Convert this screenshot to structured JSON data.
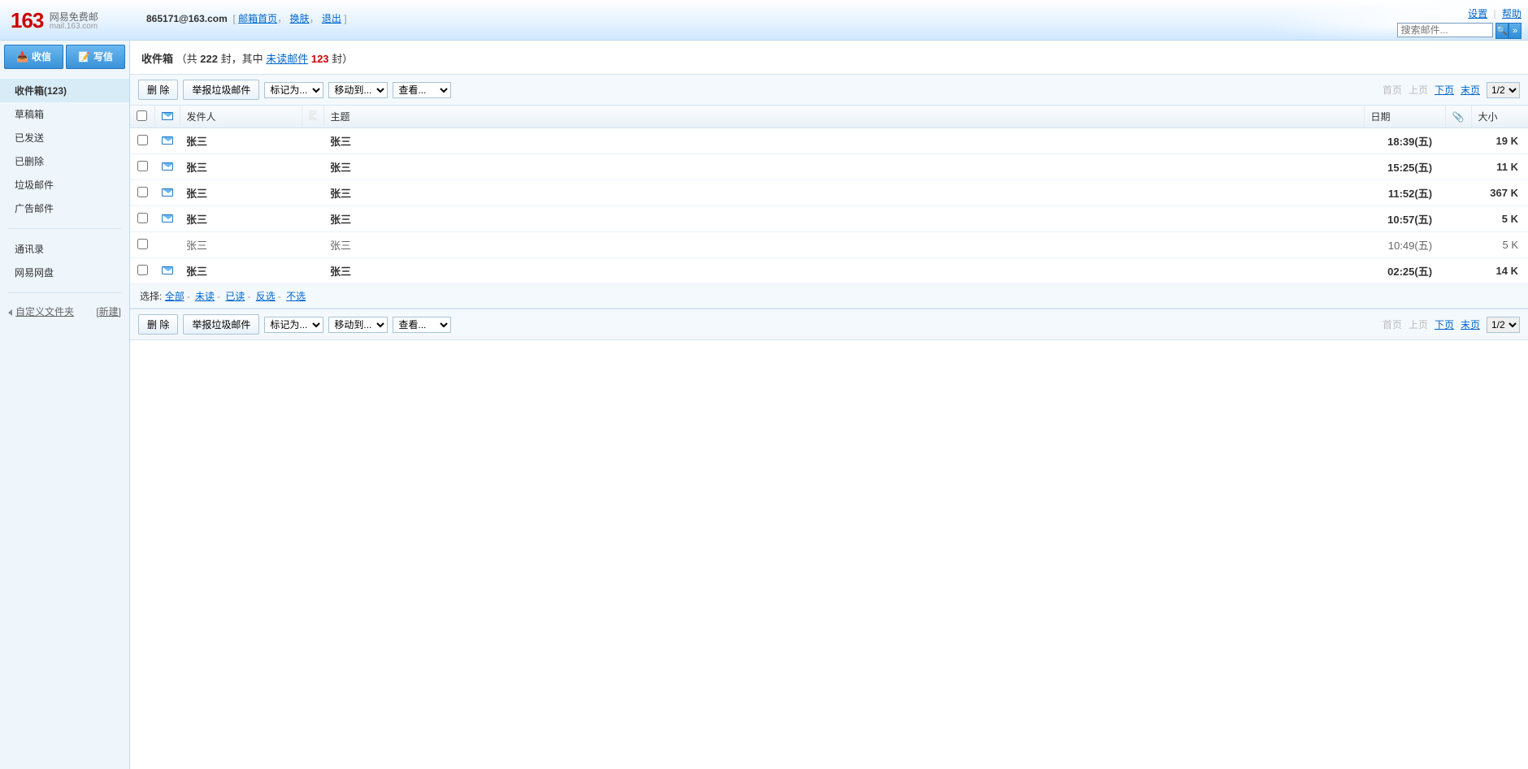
{
  "header": {
    "logo_num": "163",
    "logo_text": "网易免费邮",
    "logo_sub": "mail.163.com",
    "user_email": "865171@163.com",
    "links": {
      "home": "邮箱首页",
      "switch": "换肤",
      "logout": "退出"
    },
    "settings": "设置",
    "help": "帮助",
    "search_placeholder": "搜索邮件..."
  },
  "sidebar": {
    "receive": "收信",
    "compose": "写信",
    "folders": [
      {
        "label": "收件箱(123)",
        "active": true
      },
      {
        "label": "草稿箱"
      },
      {
        "label": "已发送"
      },
      {
        "label": "已删除"
      },
      {
        "label": "垃圾邮件"
      },
      {
        "label": "广告邮件"
      }
    ],
    "extras": [
      {
        "label": "通讯录"
      },
      {
        "label": "网易网盘"
      }
    ],
    "custom_label": "自定义文件夹",
    "new_label": "[新建]"
  },
  "inbox": {
    "title": "收件箱",
    "stat_prefix": "（共 ",
    "total": "222",
    "stat_mid": " 封，其中 ",
    "unread_label": "未读邮件",
    "unread": "123",
    "stat_suffix": " 封）"
  },
  "toolbar": {
    "delete": "删 除",
    "spam": "举报垃圾邮件",
    "mark_as": "标记为...",
    "move_to": "移动到...",
    "view": "查看..."
  },
  "pagination": {
    "first": "首页",
    "prev": "上页",
    "next": "下页",
    "last": "末页",
    "current": "1/2"
  },
  "columns": {
    "sender": "发件人",
    "subject": "主题",
    "date": "日期",
    "size": "大小"
  },
  "mails": [
    {
      "sender": "张三",
      "subject": "张三",
      "date": "18:39(五)",
      "size": "19 K",
      "unread": true,
      "hasIcon": true
    },
    {
      "sender": "张三",
      "subject": "张三",
      "date": "15:25(五)",
      "size": "11 K",
      "unread": true,
      "hasIcon": true
    },
    {
      "sender": "张三",
      "subject": "张三",
      "date": "11:52(五)",
      "size": "367 K",
      "unread": true,
      "hasIcon": true
    },
    {
      "sender": "张三",
      "subject": "张三",
      "date": "10:57(五)",
      "size": "5 K",
      "unread": true,
      "hasIcon": true
    },
    {
      "sender": "张三",
      "subject": "张三",
      "date": "10:49(五)",
      "size": "5 K",
      "unread": false,
      "hasIcon": false
    },
    {
      "sender": "张三",
      "subject": "张三",
      "date": "02:25(五)",
      "size": "14 K",
      "unread": true,
      "hasIcon": true
    }
  ],
  "select": {
    "label": "选择:",
    "all": "全部",
    "unread": "未读",
    "read": "已读",
    "invert": "反选",
    "none": "不选"
  }
}
